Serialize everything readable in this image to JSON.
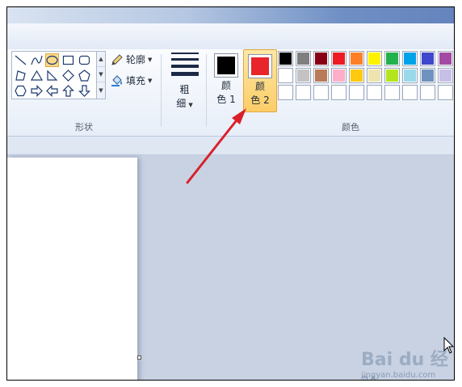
{
  "ribbon": {
    "shapes_group_label": "形状",
    "outline_label": "轮廓",
    "fill_label": "填充",
    "width_label_line1": "粗",
    "width_label_line2": "细",
    "color1_line1": "颜",
    "color1_line2": "色 1",
    "color2_line1": "颜",
    "color2_line2": "色 2",
    "colors_group_label": "颜色"
  },
  "colors": {
    "color1": "#000000",
    "color2": "#e8252a",
    "palette_row1": [
      "#000000",
      "#7f7f7f",
      "#880015",
      "#ed1c24",
      "#ff7f27",
      "#fff200",
      "#22b14c",
      "#00a2e8",
      "#3f48cc",
      "#a349a4"
    ],
    "palette_row2": [
      "#ffffff",
      "#c3c3c3",
      "#b97a57",
      "#ffaec9",
      "#ffc90e",
      "#efe4b0",
      "#b5e61d",
      "#99d9ea",
      "#7092be",
      "#c8bfe7"
    ],
    "palette_row3": [
      "#ffffff",
      "#ffffff",
      "#ffffff",
      "#ffffff",
      "#ffffff",
      "#ffffff",
      "#ffffff",
      "#ffffff",
      "#ffffff",
      "#ffffff"
    ]
  },
  "shapes": [
    "line",
    "curve",
    "oval",
    "rectangle",
    "rounded-rectangle",
    "polygon",
    "triangle",
    "right-triangle",
    "diamond",
    "pentagon",
    "hexagon",
    "right-arrow",
    "left-arrow",
    "up-arrow",
    "down-arrow"
  ],
  "watermark": {
    "brand": "Bai du 经验",
    "url": "jingyan.baidu.com"
  },
  "annotation_color": "#d9202a"
}
